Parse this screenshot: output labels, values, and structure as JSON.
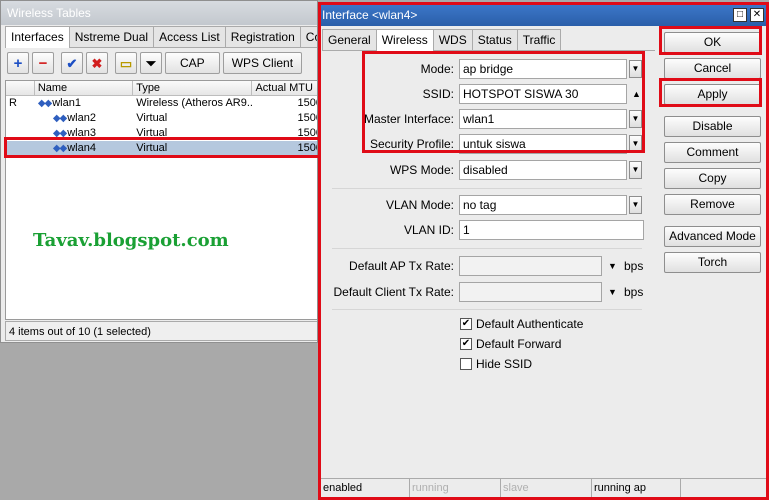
{
  "wireless_tables": {
    "title": "Wireless Tables",
    "tabs": [
      "Interfaces",
      "Nstreme Dual",
      "Access List",
      "Registration",
      "Connect List"
    ],
    "toolbar": {
      "add": "+",
      "remove": "−",
      "enable": "✔",
      "disable": "✖",
      "comment": "▭",
      "filter": "⏷",
      "cap": "CAP",
      "wps_client": "WPS Client"
    },
    "columns": [
      "",
      "Name",
      "Type",
      "Actual MTU"
    ],
    "rows": [
      {
        "flag": "R",
        "name": "wlan1",
        "type": "Wireless (Atheros AR9...",
        "mtu": "1500"
      },
      {
        "flag": "",
        "name": "wlan2",
        "type": "Virtual",
        "mtu": "1500"
      },
      {
        "flag": "",
        "name": "wlan3",
        "type": "Virtual",
        "mtu": "1500"
      },
      {
        "flag": "",
        "name": "wlan4",
        "type": "Virtual",
        "mtu": "1500"
      }
    ],
    "status": "4 items out of 10 (1 selected)",
    "watermark": "Tavav.blogspot.com"
  },
  "interface_window": {
    "title": "Interface <wlan4>",
    "tabs": [
      "General",
      "Wireless",
      "WDS",
      "Status",
      "Traffic"
    ],
    "active_tab": "Wireless",
    "fields": {
      "mode": {
        "label": "Mode:",
        "value": "ap bridge"
      },
      "ssid": {
        "label": "SSID:",
        "value": "HOTSPOT SISWA 30"
      },
      "master_interface": {
        "label": "Master Interface:",
        "value": "wlan1"
      },
      "security_profile": {
        "label": "Security Profile:",
        "value": "untuk siswa"
      },
      "wps_mode": {
        "label": "WPS Mode:",
        "value": "disabled"
      },
      "vlan_mode": {
        "label": "VLAN Mode:",
        "value": "no tag"
      },
      "vlan_id": {
        "label": "VLAN ID:",
        "value": "1"
      },
      "default_ap_tx_rate": {
        "label": "Default AP Tx Rate:",
        "value": "",
        "unit": "bps"
      },
      "default_client_tx_rate": {
        "label": "Default Client Tx Rate:",
        "value": "",
        "unit": "bps"
      }
    },
    "checkboxes": [
      {
        "label": "Default Authenticate",
        "checked": true
      },
      {
        "label": "Default Forward",
        "checked": true
      },
      {
        "label": "Hide SSID",
        "checked": false
      }
    ],
    "buttons": [
      "OK",
      "Cancel",
      "Apply",
      "Disable",
      "Comment",
      "Copy",
      "Remove",
      "Advanced Mode",
      "Torch"
    ],
    "status_bar": [
      "enabled",
      "running",
      "slave",
      "running ap"
    ],
    "highlight_color": "#e00b17"
  }
}
